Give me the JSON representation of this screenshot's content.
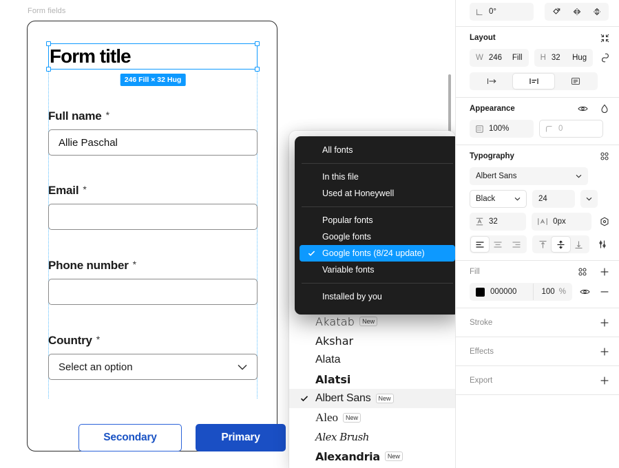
{
  "canvas": {
    "frame_label": "Form fields",
    "form": {
      "title": "Form title",
      "selection_badge": "246 Fill × 32 Hug",
      "fields": [
        {
          "label": "Full name",
          "required": "*",
          "value": "Allie Paschal",
          "placeholder": ""
        },
        {
          "label": "Email",
          "required": "*",
          "value": "",
          "placeholder": ""
        },
        {
          "label": "Phone number",
          "required": "*",
          "value": "",
          "placeholder": ""
        },
        {
          "label": "Country",
          "required": "*",
          "value": "Select an option",
          "type": "select"
        }
      ],
      "buttons": {
        "secondary": "Secondary",
        "primary": "Primary"
      }
    }
  },
  "font_menu": {
    "groups": [
      {
        "items": [
          {
            "label": "All fonts",
            "checked": false
          }
        ]
      },
      {
        "items": [
          {
            "label": "In this file",
            "checked": false
          },
          {
            "label": "Used at Honeywell",
            "checked": false
          }
        ]
      },
      {
        "items": [
          {
            "label": "Popular fonts",
            "checked": false
          },
          {
            "label": "Google fonts",
            "checked": false
          },
          {
            "label": "Google fonts (8/24 update)",
            "checked": true
          },
          {
            "label": "Variable fonts",
            "checked": false
          }
        ]
      },
      {
        "items": [
          {
            "label": "Installed by you",
            "checked": false
          }
        ]
      }
    ]
  },
  "font_list": {
    "items": [
      {
        "name": "Akatab",
        "badge": "New",
        "checked": false,
        "style": "fn-akatab"
      },
      {
        "name": "Akshar",
        "badge": "",
        "checked": false,
        "style": "fn-akshar"
      },
      {
        "name": "Alata",
        "badge": "",
        "checked": false,
        "style": "fn-alata"
      },
      {
        "name": "Alatsi",
        "badge": "",
        "checked": false,
        "style": "fn-alatsi"
      },
      {
        "name": "Albert Sans",
        "badge": "New",
        "checked": true,
        "style": "fn-albert"
      },
      {
        "name": "Aleo",
        "badge": "New",
        "checked": false,
        "style": "fn-aleo"
      },
      {
        "name": "Alex Brush",
        "badge": "",
        "checked": false,
        "style": "fn-alexbrush"
      },
      {
        "name": "Alexandria",
        "badge": "New",
        "checked": false,
        "style": "fn-alexandria"
      }
    ]
  },
  "inspector": {
    "transform": {
      "rotation": "0°"
    },
    "layout": {
      "title": "Layout",
      "width_label": "W",
      "width_value": "246",
      "width_mode": "Fill",
      "height_label": "H",
      "height_value": "32",
      "height_mode": "Hug"
    },
    "appearance": {
      "title": "Appearance",
      "opacity": "100%",
      "corner_radius": "0"
    },
    "typography": {
      "title": "Typography",
      "family": "Albert Sans",
      "weight": "Black",
      "size": "24",
      "line_height": "32",
      "letter_spacing": "0px"
    },
    "fill": {
      "title": "Fill",
      "hex": "000000",
      "opacity": "100",
      "opacity_unit": "%",
      "color": "#000000"
    },
    "stroke": {
      "title": "Stroke"
    },
    "effects": {
      "title": "Effects"
    },
    "export": {
      "title": "Export"
    }
  }
}
